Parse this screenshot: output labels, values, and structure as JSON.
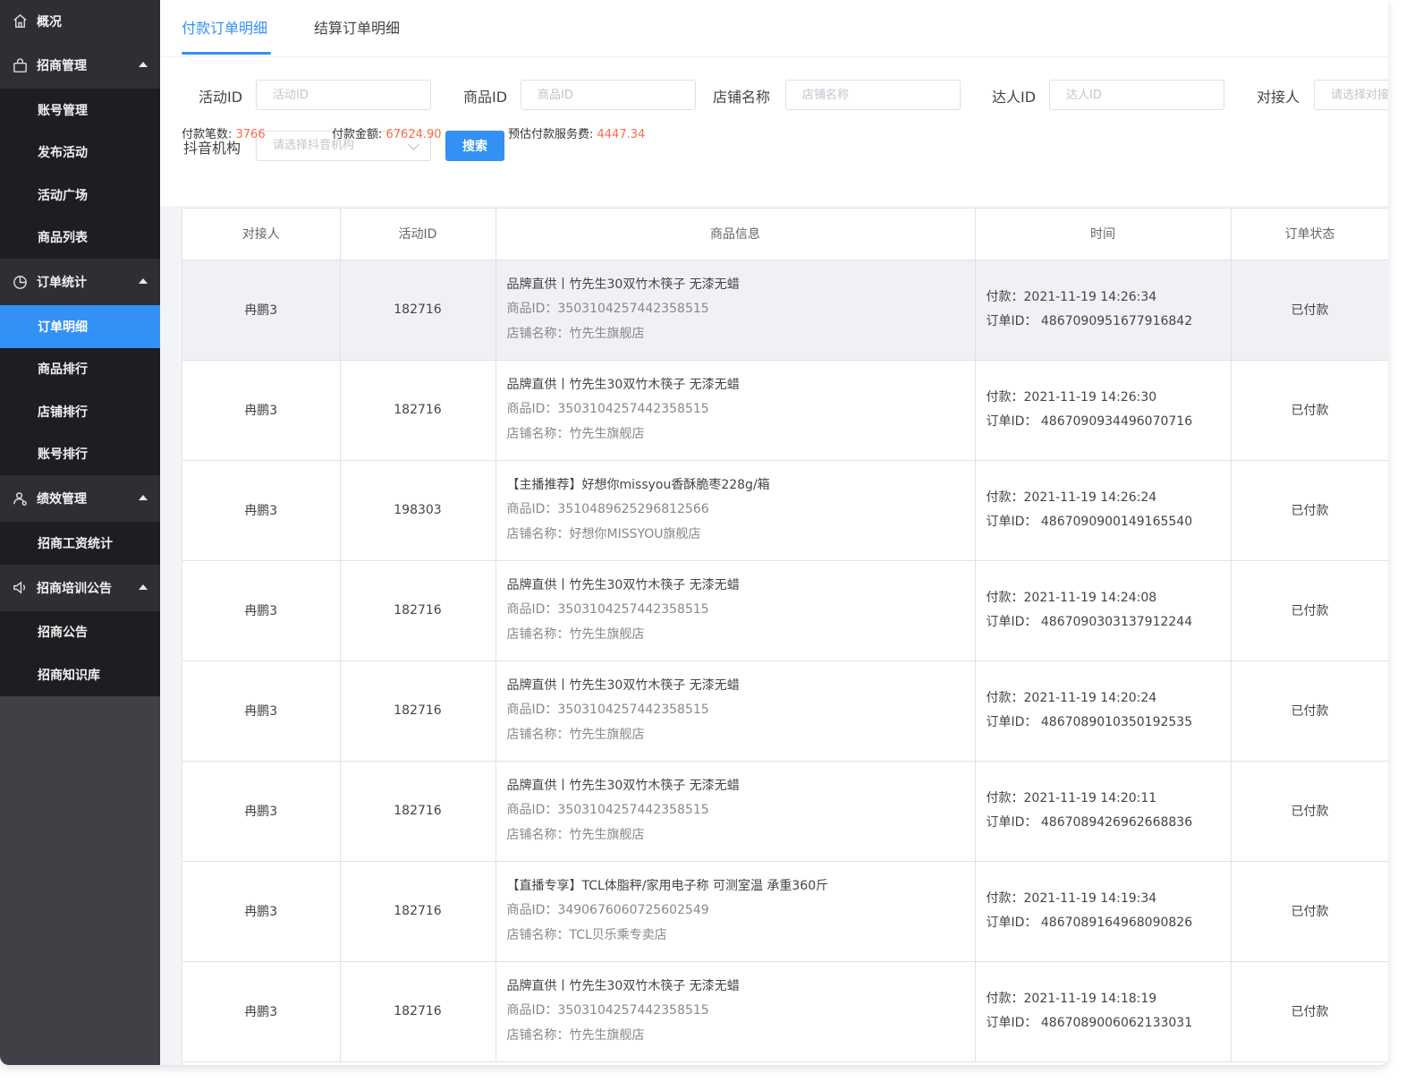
{
  "sidebar": {
    "home": {
      "label": "概况",
      "icon": "home-icon"
    },
    "groups": [
      {
        "label": "招商管理",
        "icon": "bag-icon",
        "items": [
          "账号管理",
          "发布活动",
          "活动广场",
          "商品列表"
        ]
      },
      {
        "label": "订单统计",
        "icon": "pie-chart-icon",
        "items": [
          "订单明细",
          "商品排行",
          "店铺排行",
          "账号排行"
        ]
      },
      {
        "label": "绩效管理",
        "icon": "users-icon",
        "items": [
          "招商工资统计"
        ]
      },
      {
        "label": "招商培训公告",
        "icon": "speaker-icon",
        "items": [
          "招商公告",
          "招商知识库"
        ]
      }
    ],
    "active_item": "订单明细"
  },
  "tabs": [
    {
      "label": "付款订单明细",
      "active": true
    },
    {
      "label": "结算订单明细",
      "active": false
    }
  ],
  "filters": {
    "activity_id": {
      "label": "活动ID",
      "placeholder": "活动ID"
    },
    "product_id": {
      "label": "商品ID",
      "placeholder": "商品ID"
    },
    "shop_name": {
      "label": "店铺名称",
      "placeholder": "店铺名称"
    },
    "talent_id": {
      "label": "达人ID",
      "placeholder": "达人ID"
    },
    "contact": {
      "label": "对接人",
      "placeholder": "请选择对接人"
    },
    "douyin_org": {
      "label": "抖音机构",
      "placeholder": "请选择抖音机构"
    },
    "search_button": "搜索"
  },
  "stats": {
    "count_label": "付款笔数: ",
    "count_value": "3766",
    "amount_label": "付款金额: ",
    "amount_value": "67624.90",
    "fee_label": "预估付款服务费: ",
    "fee_value": "4447.34"
  },
  "table": {
    "headers": [
      "对接人",
      "活动ID",
      "商品信息",
      "时间",
      "订单状态"
    ],
    "product_id_prefix": "商品ID：",
    "shop_prefix": "店铺名称：",
    "pay_prefix": "付款：",
    "order_prefix": "订单ID：",
    "rows": [
      {
        "contact": "冉鹏3",
        "activity_id": "182716",
        "title": "品牌直供丨竹先生30双竹木筷子 无漆无蜡",
        "product_id": "3503104257442358515",
        "shop": "竹先生旗舰店",
        "pay_time": "2021-11-19 14:26:34",
        "order_id": "4867090951677916842",
        "status": "已付款"
      },
      {
        "contact": "冉鹏3",
        "activity_id": "182716",
        "title": "品牌直供丨竹先生30双竹木筷子 无漆无蜡",
        "product_id": "3503104257442358515",
        "shop": "竹先生旗舰店",
        "pay_time": "2021-11-19 14:26:30",
        "order_id": "4867090934496070716",
        "status": "已付款"
      },
      {
        "contact": "冉鹏3",
        "activity_id": "198303",
        "title": "【主播推荐】好想你missyou香酥脆枣228g/箱",
        "product_id": "3510489625296812566",
        "shop": "好想你MISSYOU旗舰店",
        "pay_time": "2021-11-19 14:26:24",
        "order_id": "4867090900149165540",
        "status": "已付款"
      },
      {
        "contact": "冉鹏3",
        "activity_id": "182716",
        "title": "品牌直供丨竹先生30双竹木筷子 无漆无蜡",
        "product_id": "3503104257442358515",
        "shop": "竹先生旗舰店",
        "pay_time": "2021-11-19 14:24:08",
        "order_id": "4867090303137912244",
        "status": "已付款"
      },
      {
        "contact": "冉鹏3",
        "activity_id": "182716",
        "title": "品牌直供丨竹先生30双竹木筷子 无漆无蜡",
        "product_id": "3503104257442358515",
        "shop": "竹先生旗舰店",
        "pay_time": "2021-11-19 14:20:24",
        "order_id": "4867089010350192535",
        "status": "已付款"
      },
      {
        "contact": "冉鹏3",
        "activity_id": "182716",
        "title": "品牌直供丨竹先生30双竹木筷子 无漆无蜡",
        "product_id": "3503104257442358515",
        "shop": "竹先生旗舰店",
        "pay_time": "2021-11-19 14:20:11",
        "order_id": "4867089426962668836",
        "status": "已付款"
      },
      {
        "contact": "冉鹏3",
        "activity_id": "182716",
        "title": "【直播专享】TCL体脂秤/家用电子称 可测室温 承重360斤",
        "product_id": "3490676060725602549",
        "shop": "TCL贝乐乘专卖店",
        "pay_time": "2021-11-19 14:19:34",
        "order_id": "4867089164968090826",
        "status": "已付款"
      },
      {
        "contact": "冉鹏3",
        "activity_id": "182716",
        "title": "品牌直供丨竹先生30双竹木筷子 无漆无蜡",
        "product_id": "3503104257442358515",
        "shop": "竹先生旗舰店",
        "pay_time": "2021-11-19 14:18:19",
        "order_id": "4867089006062133031",
        "status": "已付款"
      }
    ]
  },
  "colors": {
    "accent": "#3390f5",
    "highlight_value": "#f56c49",
    "sidebar_bg": "#404046",
    "submenu_bg": "#1e1e22"
  }
}
